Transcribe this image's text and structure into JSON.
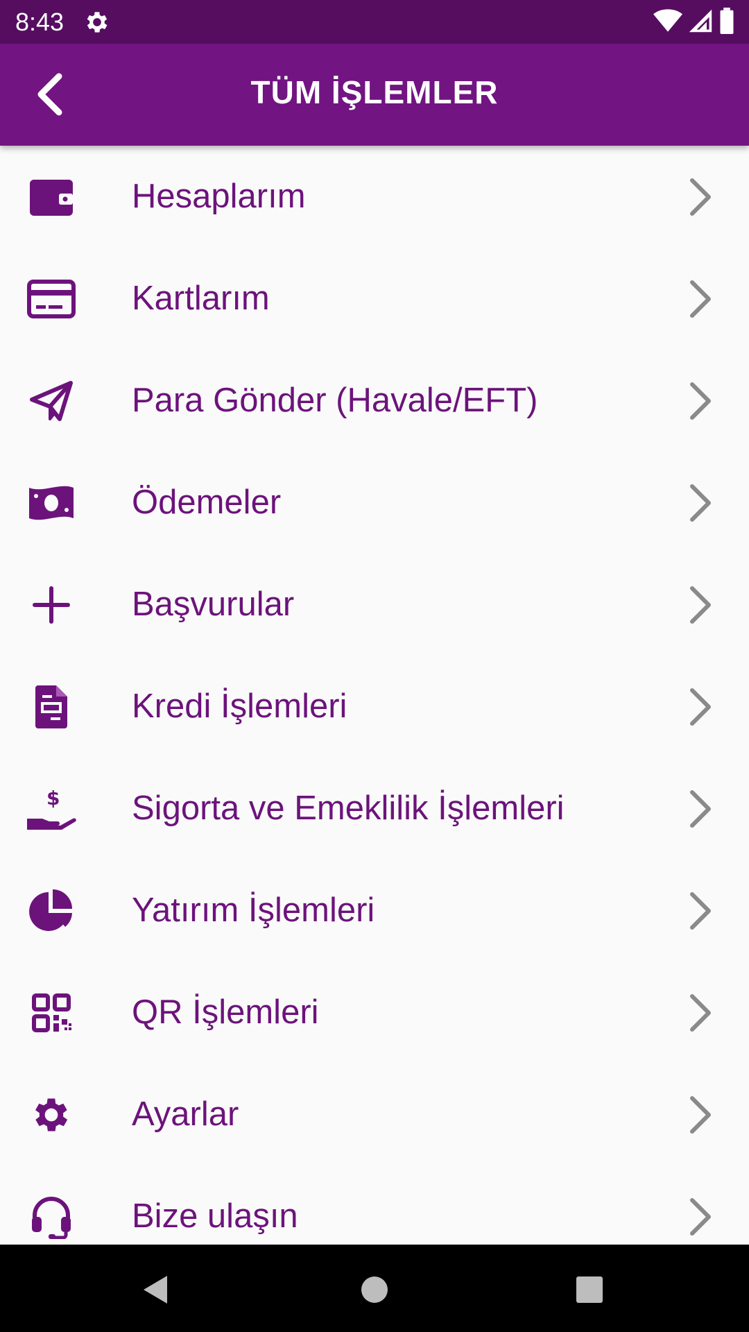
{
  "status_bar": {
    "time": "8:43",
    "icons": [
      "settings-icon",
      "wifi-icon",
      "signal-icon",
      "battery-icon"
    ]
  },
  "app_bar": {
    "title": "TÜM İŞLEMLER",
    "back_icon": "chevron-left-icon"
  },
  "menu": {
    "items": [
      {
        "label": "Hesaplarım",
        "icon": "wallet-icon"
      },
      {
        "label": "Kartlarım",
        "icon": "credit-card-icon"
      },
      {
        "label": "Para Gönder (Havale/EFT)",
        "icon": "send-icon"
      },
      {
        "label": "Ödemeler",
        "icon": "money-icon"
      },
      {
        "label": "Başvurular",
        "icon": "plus-icon"
      },
      {
        "label": "Kredi İşlemleri",
        "icon": "document-icon"
      },
      {
        "label": "Sigorta ve Emeklilik İşlemleri",
        "icon": "hand-money-icon"
      },
      {
        "label": "Yatırım İşlemleri",
        "icon": "pie-chart-icon"
      },
      {
        "label": "QR İşlemleri",
        "icon": "qr-code-icon"
      },
      {
        "label": "Ayarlar",
        "icon": "gear-icon"
      },
      {
        "label": "Bize ulaşın",
        "icon": "headset-icon"
      }
    ]
  },
  "nav_bar": {
    "buttons": [
      "back-triangle-icon",
      "home-circle-icon",
      "recents-square-icon"
    ]
  },
  "colors": {
    "status_bar": "#560d60",
    "app_bar": "#721482",
    "item_text": "#6c137b",
    "chevron": "#8a8a8a",
    "background": "#fafafa"
  }
}
